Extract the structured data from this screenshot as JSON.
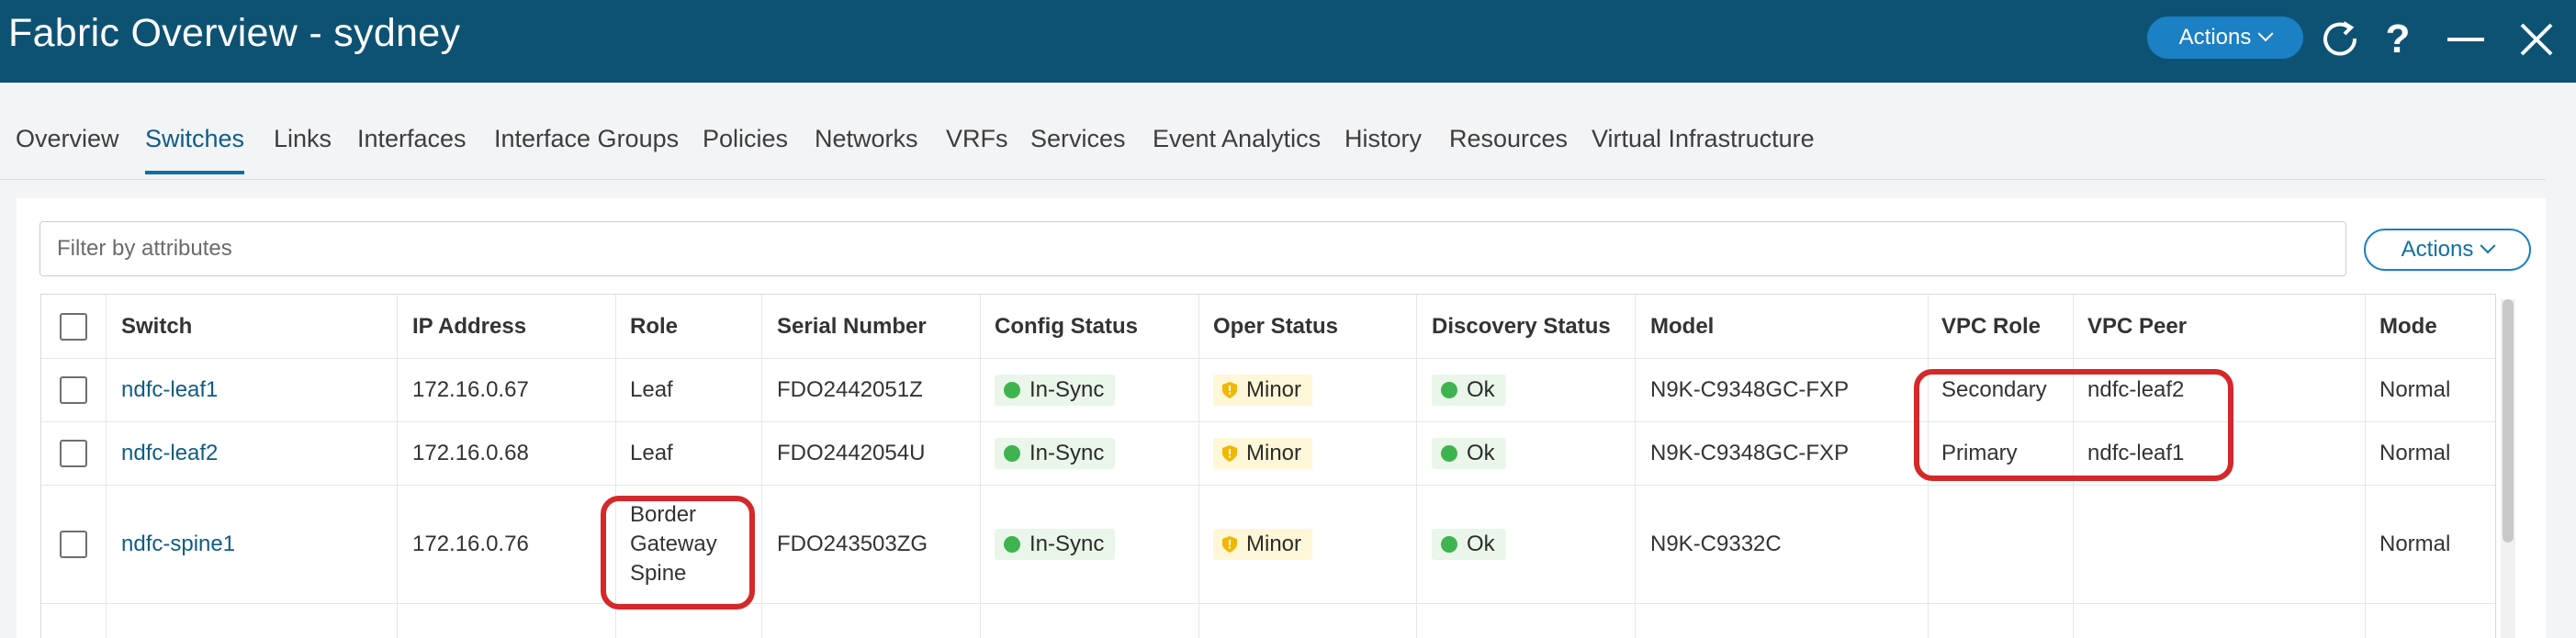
{
  "header": {
    "title": "Fabric Overview - sydney",
    "actions_label": "Actions"
  },
  "tabs": [
    {
      "label": "Overview"
    },
    {
      "label": "Switches",
      "active": true
    },
    {
      "label": "Links"
    },
    {
      "label": "Interfaces"
    },
    {
      "label": "Interface Groups"
    },
    {
      "label": "Policies"
    },
    {
      "label": "Networks"
    },
    {
      "label": "VRFs"
    },
    {
      "label": "Services"
    },
    {
      "label": "Event Analytics"
    },
    {
      "label": "History"
    },
    {
      "label": "Resources"
    },
    {
      "label": "Virtual Infrastructure"
    }
  ],
  "filter": {
    "placeholder": "Filter by attributes",
    "value": ""
  },
  "panel": {
    "actions_label": "Actions"
  },
  "table": {
    "columns": [
      "Switch",
      "IP Address",
      "Role",
      "Serial Number",
      "Config Status",
      "Oper Status",
      "Discovery Status",
      "Model",
      "VPC Role",
      "VPC Peer",
      "Mode"
    ],
    "rows": [
      {
        "switch": "ndfc-leaf1",
        "ip": "172.16.0.67",
        "role": "Leaf",
        "serial": "FDO2442051Z",
        "config_status": "In-Sync",
        "oper_status": "Minor",
        "discovery_status": "Ok",
        "model": "N9K-C9348GC-FXP",
        "vpc_role": "Secondary",
        "vpc_peer": "ndfc-leaf2",
        "mode": "Normal"
      },
      {
        "switch": "ndfc-leaf2",
        "ip": "172.16.0.68",
        "role": "Leaf",
        "serial": "FDO2442054U",
        "config_status": "In-Sync",
        "oper_status": "Minor",
        "discovery_status": "Ok",
        "model": "N9K-C9348GC-FXP",
        "vpc_role": "Primary",
        "vpc_peer": "ndfc-leaf1",
        "mode": "Normal"
      },
      {
        "switch": "ndfc-spine1",
        "ip": "172.16.0.76",
        "role": "Border Gateway Spine",
        "serial": "FDO243503ZG",
        "config_status": "In-Sync",
        "oper_status": "Minor",
        "discovery_status": "Ok",
        "model": "N9K-C9332C",
        "vpc_role": "",
        "vpc_peer": "",
        "mode": "Normal"
      }
    ]
  },
  "colors": {
    "header_bg": "#0e5273",
    "accent": "#1b80c4",
    "ok_green": "#3fb34f",
    "minor_yellow": "#f2b705",
    "highlight_red": "#d4282a"
  }
}
